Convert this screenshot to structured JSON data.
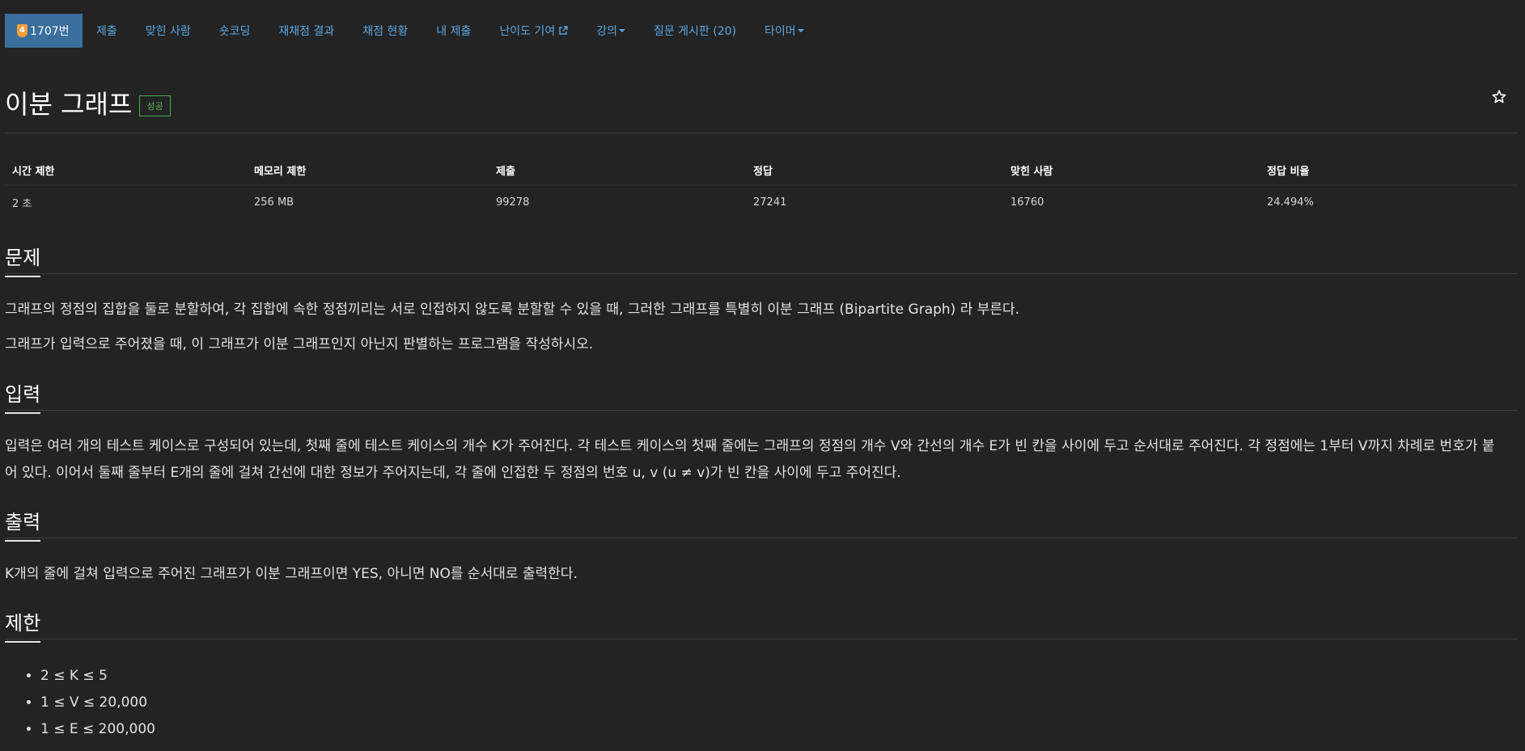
{
  "nav": {
    "tier": "4",
    "problem_number": "1707번",
    "items": [
      {
        "label": "제출"
      },
      {
        "label": "맞힌 사람"
      },
      {
        "label": "숏코딩"
      },
      {
        "label": "재채점 결과"
      },
      {
        "label": "채점 현황"
      },
      {
        "label": "내 제출"
      },
      {
        "label": "난이도 기여",
        "icon": "external-link-icon"
      },
      {
        "label": "강의",
        "dropdown": true
      },
      {
        "label": "질문 게시판 (20)"
      },
      {
        "label": "타이머",
        "dropdown": true
      }
    ]
  },
  "problem": {
    "title": "이분 그래프",
    "status": "성공",
    "star_icon": "star-icon"
  },
  "stats": {
    "headers": [
      "시간 제한",
      "메모리 제한",
      "제출",
      "정답",
      "맞힌 사람",
      "정답 비율"
    ],
    "values": [
      "2 초",
      "256 MB",
      "99278",
      "27241",
      "16760",
      "24.494%"
    ]
  },
  "sections": {
    "description": {
      "title": "문제",
      "paragraphs": [
        "그래프의 정점의 집합을 둘로 분할하여, 각 집합에 속한 정점끼리는 서로 인접하지 않도록 분할할 수 있을 때, 그러한 그래프를 특별히 이분 그래프 (Bipartite Graph) 라 부른다.",
        "그래프가 입력으로 주어졌을 때, 이 그래프가 이분 그래프인지 아닌지 판별하는 프로그램을 작성하시오."
      ]
    },
    "input": {
      "title": "입력",
      "line1": "입력은 여러 개의 테스트 케이스로 구성되어 있는데, 첫째 줄에 테스트 케이스의 개수 K가 주어진다. 각 테스트 케이스의 첫째 줄에는 그래프의 정점의 개수 V와 간선의 개수 E가 빈 칸을 사이에 두고 순서대로 주어진다. 각 정점에는 1부터 V까지 차례로 번호가 붙",
      "line2": "어 있다. 이어서 둘째 줄부터 E개의 줄에 걸쳐 간선에 대한 정보가 주어지는데, 각 줄에 인접한 두 정점의 번호 u, v (u ≠ v)가 빈 칸을 사이에 두고 주어진다."
    },
    "output": {
      "title": "출력",
      "text": "K개의 줄에 걸쳐 입력으로 주어진 그래프가 이분 그래프이면 YES, 아니면 NO를 순서대로 출력한다."
    },
    "limits": {
      "title": "제한",
      "items": [
        "2 ≤ K ≤ 5",
        "1 ≤ V ≤ 20,000",
        "1 ≤ E ≤ 200,000"
      ]
    }
  },
  "colors": {
    "background": "#232323",
    "link": "#5aa7e4",
    "active_tab": "#3a6e9c",
    "success": "#5cb85c",
    "tier_gold": "#f2a03d"
  }
}
